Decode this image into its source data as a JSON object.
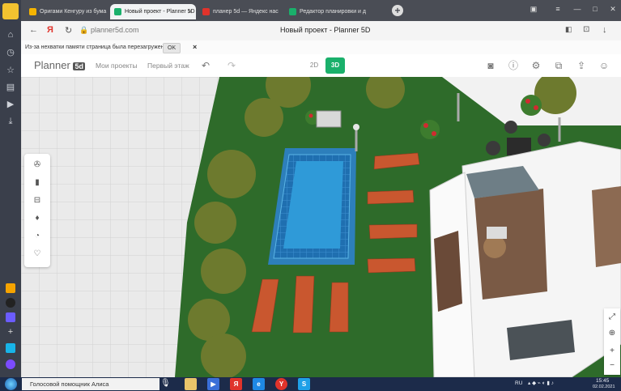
{
  "browser": {
    "tabs": [
      {
        "title": "Оригами Кенгуру из бума",
        "favicon_color": "#f5b400"
      },
      {
        "title": "Новый проект - Planner 5D",
        "favicon_color": "#1ab06b"
      },
      {
        "title": "планер 5d — Яндекс нас",
        "favicon_color": "#e0332b"
      },
      {
        "title": "Редактор планировки и д",
        "favicon_color": "#1ab06b"
      }
    ],
    "new_tab": "+",
    "url": "planner5d.com",
    "page_title": "Новый проект - Planner 5D"
  },
  "infobar": {
    "message": "Из-за нехватки памяти страница была перезагружена",
    "ok_label": "OK",
    "close": "×"
  },
  "planner": {
    "logo_text": "Planner",
    "logo_badge": "5d",
    "my_projects": "Мои проекты",
    "floor": "Первый этаж",
    "mode_2d": "2D",
    "mode_3d": "3D",
    "accent": "#1ab06b"
  },
  "taskbar": {
    "assistant": "Голосовой помощник Алиса",
    "lang": "RU",
    "time": "15:45",
    "date": "02.02.2021"
  }
}
